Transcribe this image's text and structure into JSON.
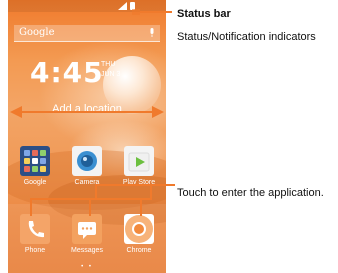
{
  "phone": {
    "search": {
      "provider": "Google"
    },
    "clock": {
      "time": "4:45",
      "day": "THU",
      "date": "JUN 3"
    },
    "location_hint": "Add a location",
    "apps": [
      {
        "label": "Google",
        "icon": "google-folder-icon"
      },
      {
        "label": "Camera",
        "icon": "camera-icon"
      },
      {
        "label": "Play Store",
        "icon": "play-store-icon"
      }
    ],
    "dock": [
      {
        "label": "Phone",
        "icon": "phone-icon"
      },
      {
        "label": "Messages",
        "icon": "messages-icon"
      },
      {
        "label": "Chrome",
        "icon": "chrome-icon"
      }
    ],
    "pager": "• •"
  },
  "annotations": {
    "status_bar_title": "Status bar",
    "status_bar_desc": "Status/Notification indicators",
    "touch_hint": "Touch to enter the application."
  },
  "colors": {
    "accent": "#f07a2c",
    "wallpaper_top": "#f07a2c",
    "wallpaper_mid": "#f3a566"
  }
}
